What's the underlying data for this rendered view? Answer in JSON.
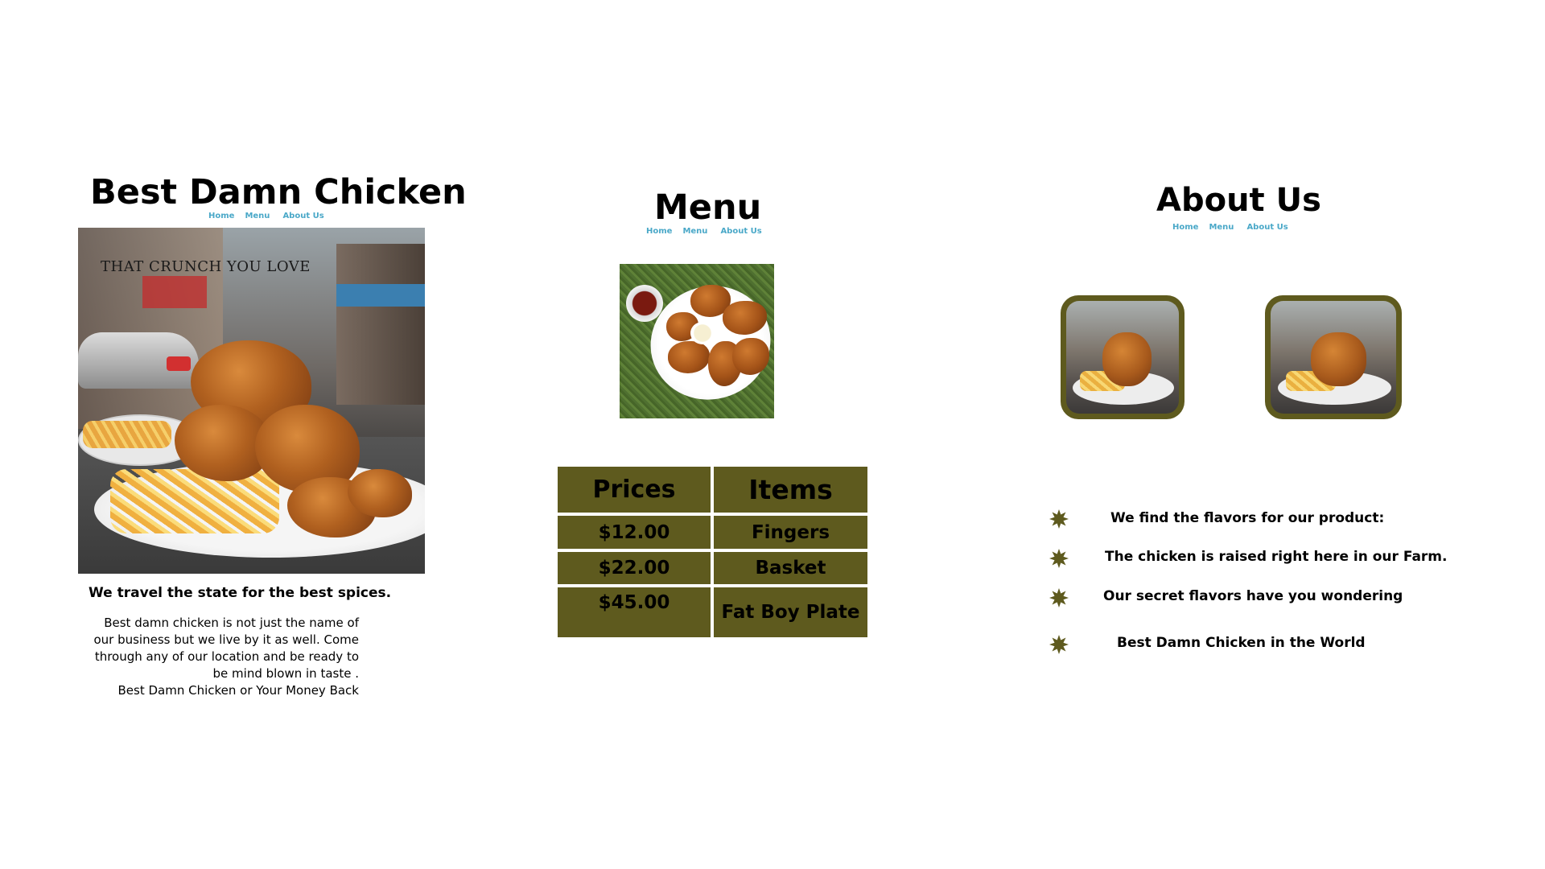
{
  "home_panel": {
    "title": "Best Damn Chicken",
    "nav": [
      "Home",
      "Menu",
      "About Us"
    ],
    "hero_tagline": "THAT CRUNCH YOU LOVE",
    "subheading": "We travel the state for the best spices.",
    "body_lines": [
      "Best damn chicken is not just the name of",
      "our business but we live by it as well. Come",
      "through any of our location and be ready to",
      "be mind blown in taste .",
      "Best Damn Chicken or Your Money Back"
    ]
  },
  "menu_panel": {
    "title": "Menu",
    "nav": [
      "Home",
      "Menu",
      "About Us"
    ],
    "table": {
      "headers": [
        "Prices",
        "Items"
      ],
      "rows": [
        [
          "$12.00",
          "Fingers"
        ],
        [
          "$22.00",
          "Basket"
        ],
        [
          "$45.00",
          "Fat Boy Plate"
        ]
      ]
    }
  },
  "about_panel": {
    "title": "About Us",
    "nav": [
      "Home",
      "Menu",
      "About Us"
    ],
    "bullets": [
      "We find the flavors for our product:",
      "The chicken is raised right here in our Farm.",
      "Our secret flavors have you wondering",
      "Best Damn Chicken in the World"
    ]
  },
  "colors": {
    "accent_olive": "#5e5a1e",
    "nav_link": "#4aa8c8"
  },
  "icons": {
    "bullet": "starburst-icon"
  }
}
